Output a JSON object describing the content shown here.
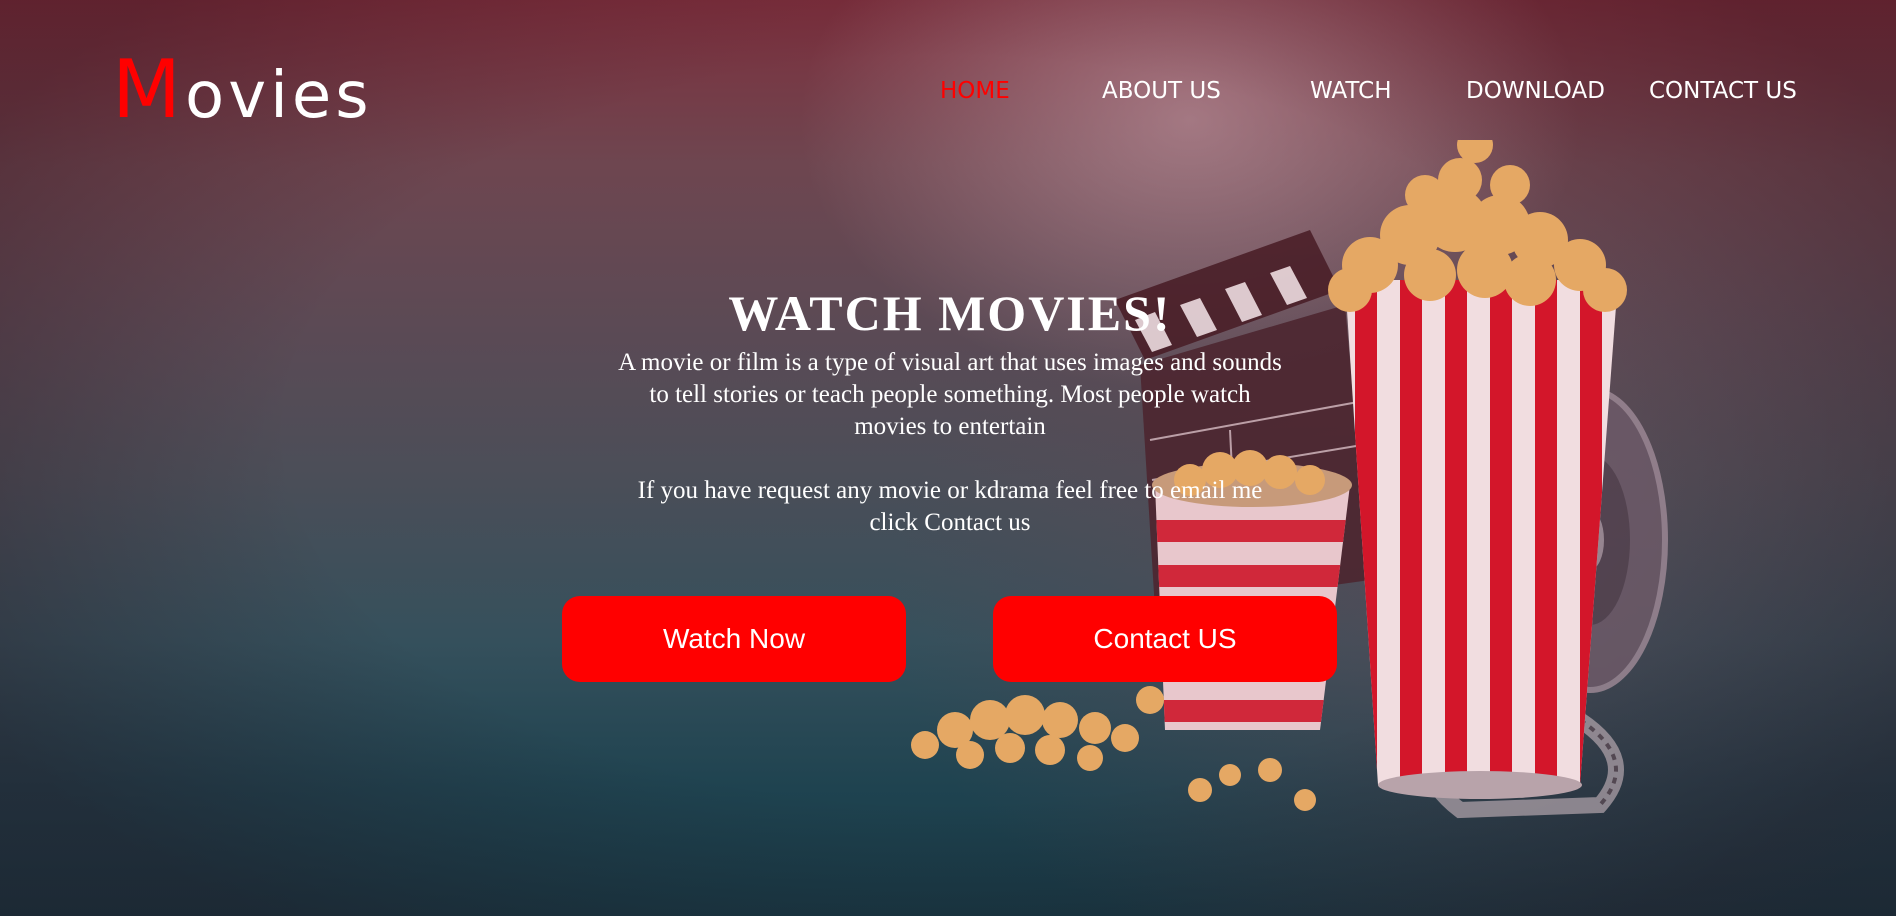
{
  "logo": {
    "first_letter": "M",
    "rest": "ovies"
  },
  "nav": [
    {
      "label": "HOME",
      "active": true
    },
    {
      "label": "ABOUT US",
      "active": false
    },
    {
      "label": "WATCH",
      "active": false
    },
    {
      "label": "DOWNLOAD",
      "active": false
    },
    {
      "label": "CONTACT US",
      "active": false
    }
  ],
  "hero": {
    "title": "WATCH MOVIES!",
    "paragraph1": "A movie or film is a type of visual art that uses images and sounds to tell stories or teach people something. Most people watch movies to entertain",
    "paragraph2": "If you have request any movie or kdrama feel free to email me click Contact us"
  },
  "buttons": {
    "watch_now": "Watch Now",
    "contact": "Contact US"
  },
  "colors": {
    "accent": "#ff0000",
    "text": "#ffffff",
    "bg_top": "#7d2f3d",
    "bg_bottom": "#163a46"
  },
  "icons": [
    "popcorn-bucket-image",
    "clapperboard-image",
    "film-reel-image"
  ]
}
